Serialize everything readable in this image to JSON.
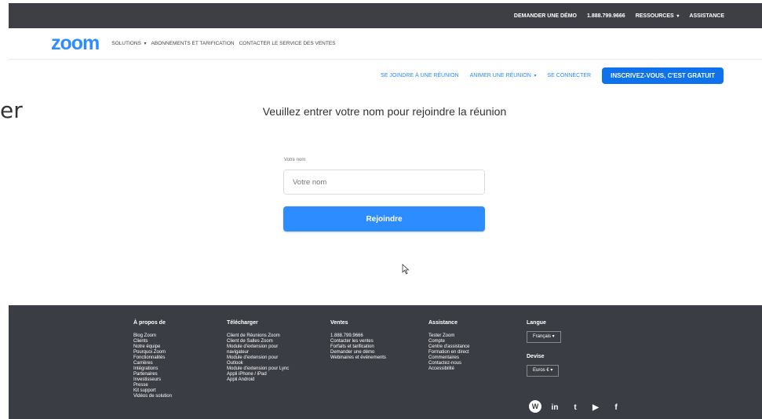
{
  "side_text": "er",
  "top_bar": {
    "demo": "DEMANDER UNE DÉMO",
    "phone": "1.888.799.9666",
    "resources": "RESSOURCES",
    "support": "ASSISTANCE"
  },
  "main_nav": {
    "logo": "zoom",
    "solutions": "SOLUTIONS",
    "plans": "ABONNEMENTS ET TARIFICATION",
    "contact_sales": "CONTACTER LE SERVICE DES VENTES"
  },
  "sub_nav": {
    "join": "SE JOINDRE À UNE RÉUNION",
    "host": "ANIMER UNE RÉUNION",
    "signin": "SE CONNECTER",
    "signup": "INSCRIVEZ-VOUS, C'EST GRATUIT"
  },
  "form": {
    "heading": "Veuillez entrer votre nom pour rejoindre la réunion",
    "label": "Votre nom",
    "placeholder": "Votre nom",
    "value": "",
    "submit": "Rejoindre"
  },
  "footer": {
    "about": {
      "heading": "À propos de",
      "items": [
        "Blog Zoom",
        "Clients",
        "Notre équipe",
        "Pourquoi Zoom",
        "Fonctionnalités",
        "Carrières",
        "Intégrations",
        "Partenaires",
        "Investisseurs",
        "Presse",
        "Kit support",
        "Vidéos de solution"
      ]
    },
    "download": {
      "heading": "Télécharger",
      "items": [
        "Client de Réunions Zoom",
        "Client de Salles Zoom",
        "Module d'extension pour",
        "navigateur",
        "Module d'extension pour",
        "Outlook",
        "Module d'extension pour Lync",
        "Appli iPhone / iPad",
        "Appli Android"
      ]
    },
    "sales": {
      "heading": "Ventes",
      "items": [
        "1.888.799.9666",
        "Contacter les ventes",
        "Forfaits et tarification",
        "Demander une démo",
        "Webinaires et événements"
      ]
    },
    "support": {
      "heading": "Assistance",
      "items": [
        "Tester Zoom",
        "Compte",
        "Centre d'assistance",
        "Formation en direct",
        "Commentaires",
        "Contactez-nous",
        "Accessibilité"
      ]
    },
    "language": {
      "heading": "Langue",
      "selected": "Français"
    },
    "currency": {
      "heading": "Devise",
      "selected": "Euros €"
    },
    "social": {
      "wordpress": "W",
      "linkedin": "in",
      "twitter": "t",
      "youtube": "▶",
      "facebook": "f"
    }
  }
}
